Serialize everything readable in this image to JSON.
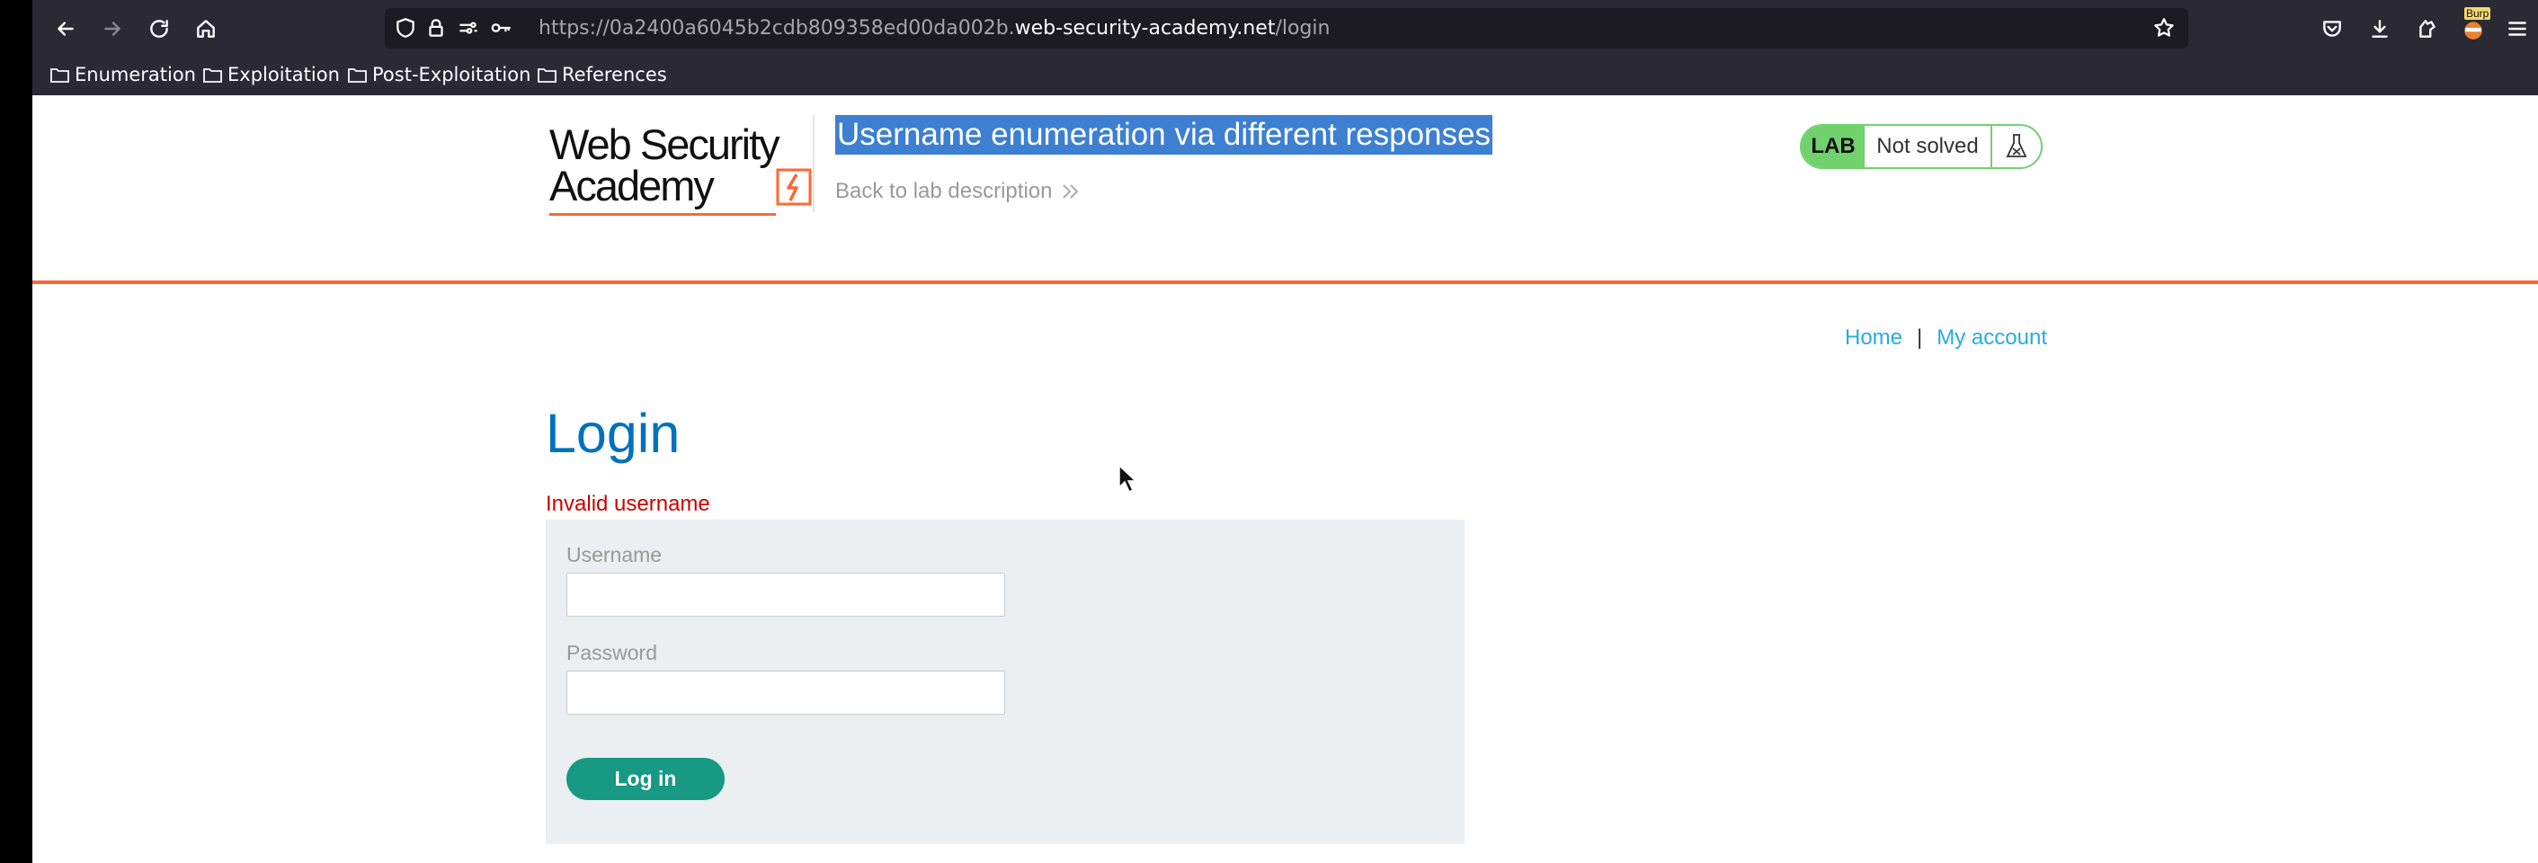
{
  "browser": {
    "url_prefix": "https://0a2400a6045b2cdb809358ed00da002b.",
    "url_host": "web-security-academy.net",
    "url_path": "/login",
    "bookmarks": [
      "Enumeration",
      "Exploitation",
      "Post-Exploitation",
      "References"
    ],
    "extension_badge": "Burp"
  },
  "header": {
    "logo_line1": "Web Security",
    "logo_line2": "Academy",
    "lab_title": "Username enumeration via different responses",
    "back_link": "Back to lab description",
    "lab_tag": "LAB",
    "lab_status": "Not solved"
  },
  "nav": {
    "home": "Home",
    "separator": "|",
    "my_account": "My account"
  },
  "login": {
    "heading": "Login",
    "error": "Invalid username",
    "username_label": "Username",
    "username_value": "",
    "password_label": "Password",
    "password_value": "",
    "button": "Log in"
  },
  "colors": {
    "accent_orange": "#ff6633",
    "heading_blue": "#0071bc",
    "link_blue": "#29abe0",
    "button_green": "#179983",
    "lab_green": "#70d16d",
    "error_red": "#cc0000"
  }
}
